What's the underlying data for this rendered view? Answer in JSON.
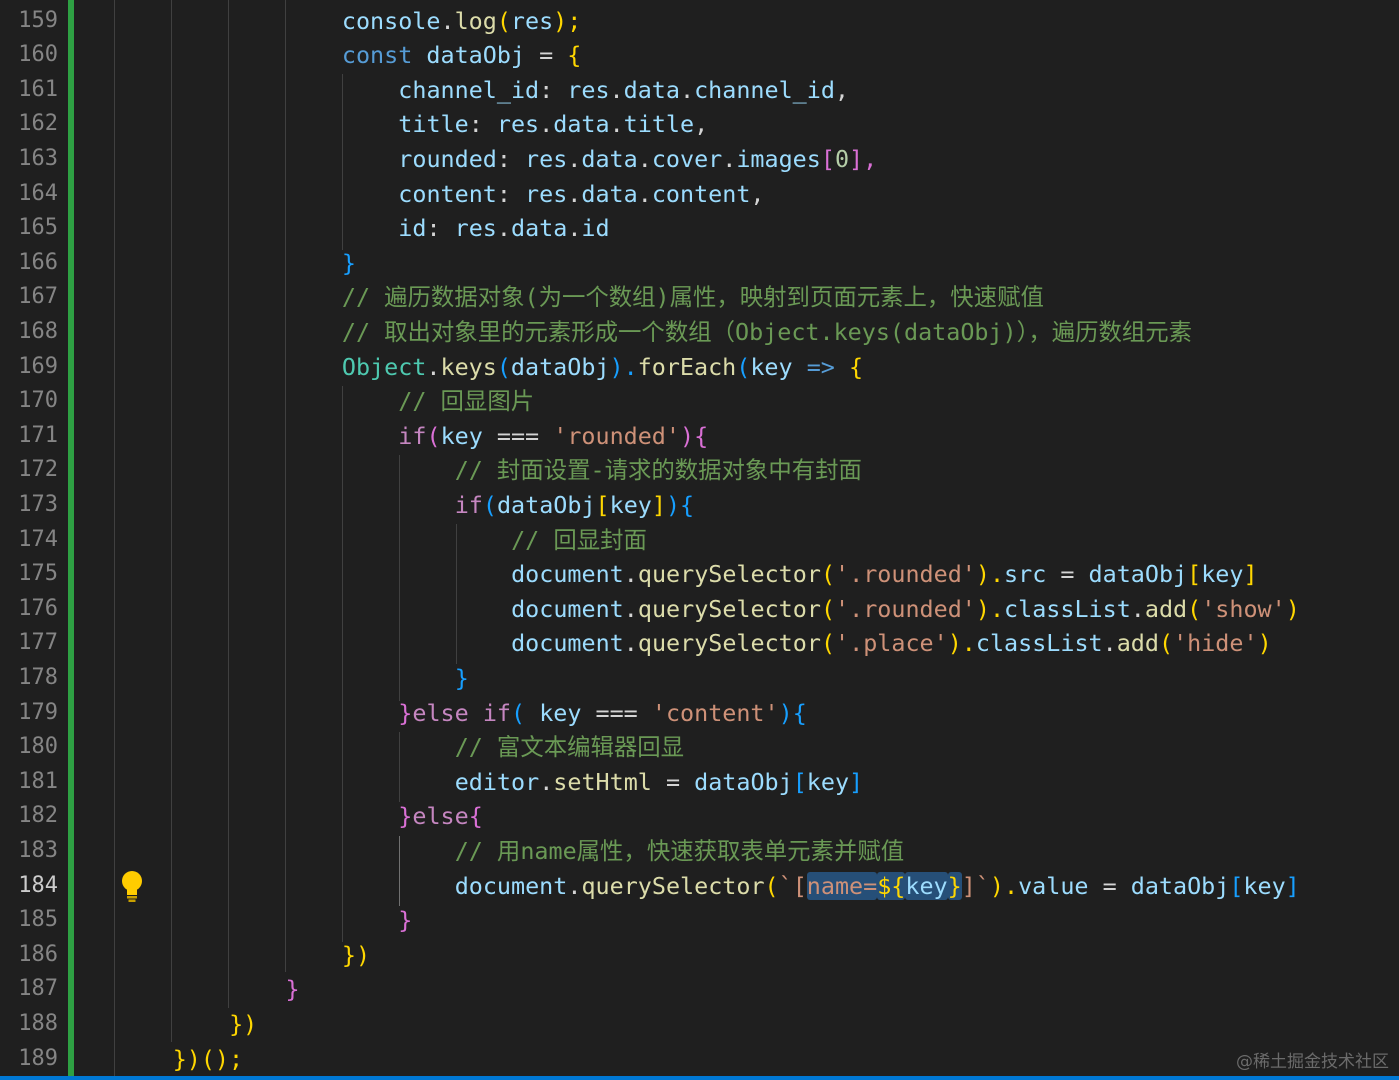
{
  "line_numbers": [
    "159",
    "160",
    "161",
    "162",
    "163",
    "164",
    "165",
    "166",
    "167",
    "168",
    "169",
    "170",
    "171",
    "172",
    "173",
    "174",
    "175",
    "176",
    "177",
    "178",
    "179",
    "180",
    "181",
    "182",
    "183",
    "184",
    "185",
    "186",
    "187",
    "188",
    "189"
  ],
  "active_line": "184",
  "code": {
    "l159": [
      "console",
      ".",
      "log",
      "(",
      "res",
      ");"
    ],
    "l160": [
      "const",
      " ",
      "dataObj",
      " = ",
      "{"
    ],
    "l161": [
      "channel_id",
      ": ",
      "res",
      ".",
      "data",
      ".",
      "channel_id",
      ","
    ],
    "l162": [
      "title",
      ": ",
      "res",
      ".",
      "data",
      ".",
      "title",
      ","
    ],
    "l163": [
      "rounded",
      ": ",
      "res",
      ".",
      "data",
      ".",
      "cover",
      ".",
      "images",
      "[",
      "0",
      "],"
    ],
    "l164": [
      "content",
      ": ",
      "res",
      ".",
      "data",
      ".",
      "content",
      ","
    ],
    "l165": [
      "id",
      ": ",
      "res",
      ".",
      "data",
      ".",
      "id"
    ],
    "l166": [
      "}"
    ],
    "l167": [
      "// 遍历数据对象(为一个数组)属性，映射到页面元素上，快速赋值"
    ],
    "l168": [
      "// 取出对象里的元素形成一个数组（Object.keys(dataObj)），遍历数组元素"
    ],
    "l169": [
      "Object",
      ".",
      "keys",
      "(",
      "dataObj",
      ").",
      "forEach",
      "(",
      "key",
      " ",
      "=>",
      " ",
      "{"
    ],
    "l170": [
      "// 回显图片"
    ],
    "l171": [
      "if",
      "(",
      "key",
      " === ",
      "'rounded'",
      "){"
    ],
    "l172": [
      "// 封面设置-请求的数据对象中有封面"
    ],
    "l173": [
      "if",
      "(",
      "dataObj",
      "[",
      "key",
      "]",
      "){"
    ],
    "l174": [
      "// 回显封面"
    ],
    "l175": [
      "document",
      ".",
      "querySelector",
      "(",
      "'.rounded'",
      ").",
      "src",
      " = ",
      "dataObj",
      "[",
      "key",
      "]"
    ],
    "l176": [
      "document",
      ".",
      "querySelector",
      "(",
      "'.rounded'",
      ").",
      "classList",
      ".",
      "add",
      "(",
      "'show'",
      ")"
    ],
    "l177": [
      "document",
      ".",
      "querySelector",
      "(",
      "'.place'",
      ").",
      "classList",
      ".",
      "add",
      "(",
      "'hide'",
      ")"
    ],
    "l178": [
      "}"
    ],
    "l179": [
      "}",
      "else",
      " ",
      "if",
      "(",
      " ",
      "key",
      " === ",
      "'content'",
      "){"
    ],
    "l180": [
      "// 富文本编辑器回显"
    ],
    "l181": [
      "editor",
      ".",
      "setHtml",
      " = ",
      "dataObj",
      "[",
      "key",
      "]"
    ],
    "l182": [
      "}",
      "else",
      "{"
    ],
    "l183": [
      "// 用name属性，快速获取表单元素并赋值"
    ],
    "l184": [
      "document",
      ".",
      "querySelector",
      "(",
      "`[",
      "name=",
      "${",
      "key",
      "}",
      "]`",
      ").",
      "value",
      " = ",
      "dataObj",
      "[",
      "key",
      "]"
    ],
    "l185": [
      "}"
    ],
    "l186": [
      "})"
    ],
    "l187": [
      "}"
    ],
    "l188": [
      "})"
    ],
    "l189": [
      "})();"
    ]
  },
  "watermark": "@稀土掘金技术社区",
  "colors": {
    "background": "#1f1f1f",
    "line_number": "#858585",
    "git_added": "#2ea043",
    "selection": "#264f78",
    "lightbulb": "#ffcc00"
  },
  "icons": {
    "gutter": "lightbulb-icon"
  }
}
